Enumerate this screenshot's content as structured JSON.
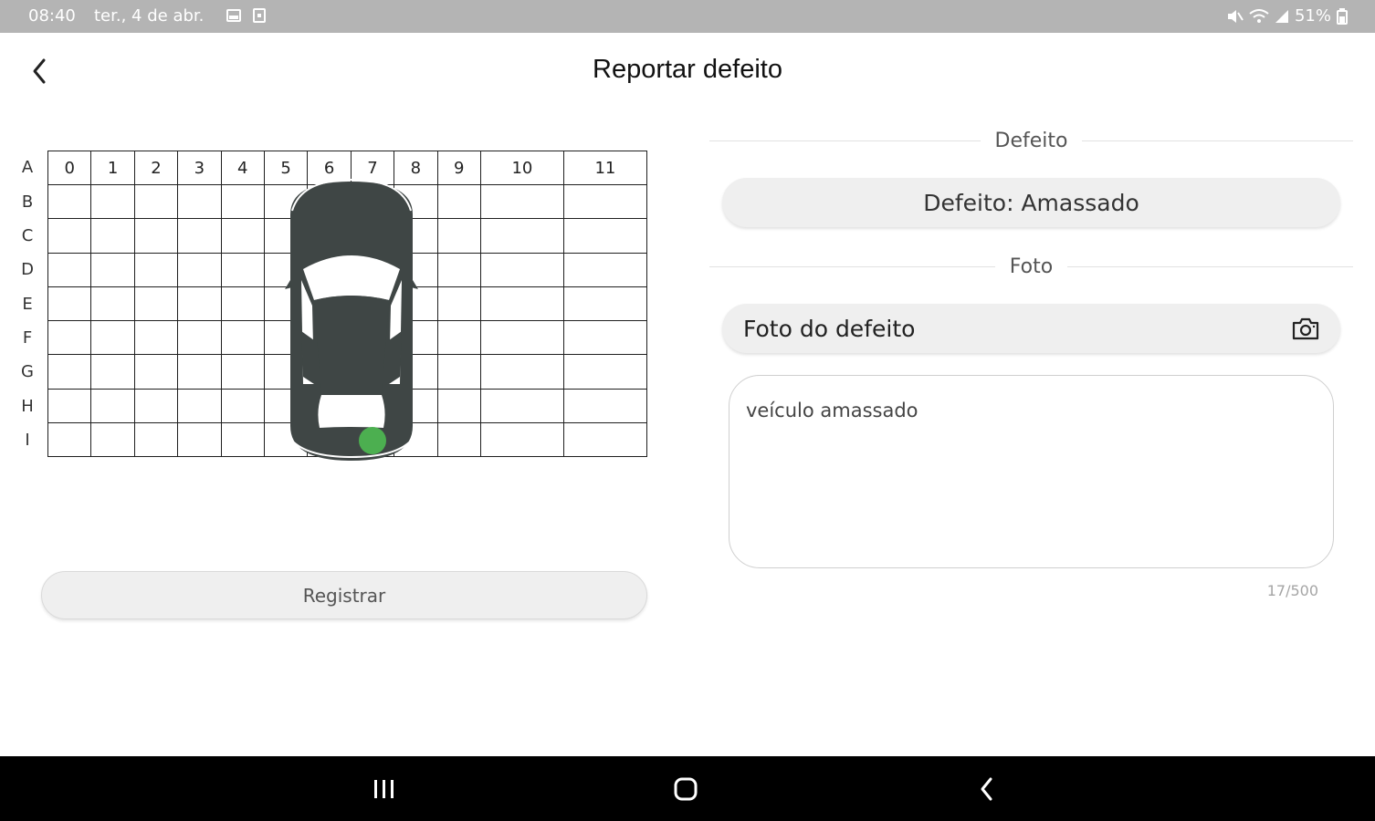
{
  "status_bar": {
    "time": "08:40",
    "date": "ter., 4 de abr.",
    "battery": "51%"
  },
  "header": {
    "title": "Reportar defeito",
    "back_icon": "chevron-left-icon"
  },
  "grid": {
    "columns": [
      "0",
      "1",
      "2",
      "3",
      "4",
      "5",
      "6",
      "7",
      "8",
      "9",
      "10",
      "11"
    ],
    "rows": [
      "A",
      "B",
      "C",
      "D",
      "E",
      "F",
      "G",
      "H",
      "I"
    ],
    "selected_marker_color": "#4caf50"
  },
  "register_button": "Registrar",
  "defect_section": {
    "title": "Defeito",
    "value": "Defeito: Amassado"
  },
  "photo_section": {
    "title": "Foto",
    "field_label": "Foto do defeito",
    "icon": "camera-icon"
  },
  "description": {
    "value": "veículo amassado",
    "counter": "17/500"
  },
  "colors": {
    "status_bar": "#b4b4b4",
    "car_body": "#3f4645",
    "marker": "#4caf50",
    "nav_bar": "#000000"
  }
}
